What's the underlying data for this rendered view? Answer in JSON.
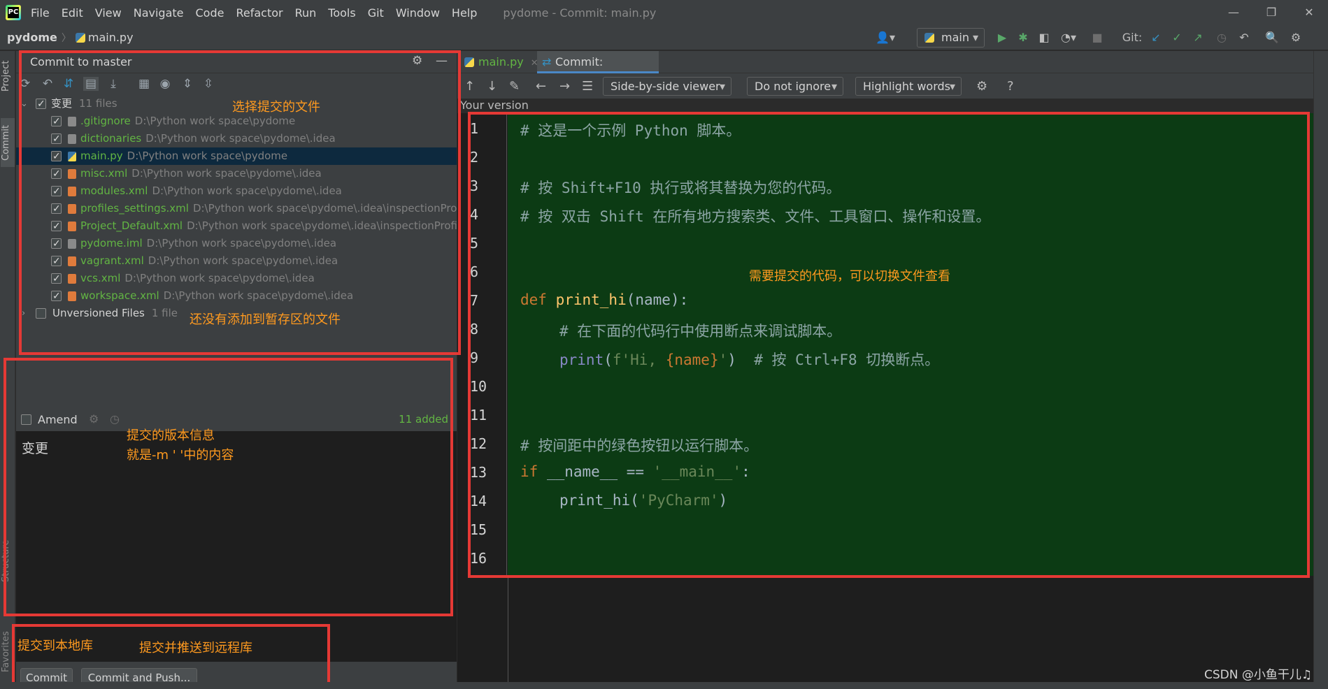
{
  "menu": [
    "File",
    "Edit",
    "View",
    "Navigate",
    "Code",
    "Refactor",
    "Run",
    "Tools",
    "Git",
    "Window",
    "Help"
  ],
  "window_title": "pydome - Commit: main.py",
  "breadcrumb": {
    "project": "pydome",
    "file": "main.py"
  },
  "branch": "main",
  "git_label": "Git:",
  "left_stripe": {
    "project": "Project",
    "commit": "Commit",
    "structure": "Structure",
    "favorites": "Favorites"
  },
  "commit_panel": {
    "title": "Commit to master",
    "changes_group": "变更",
    "changes_count": "11 files",
    "files": [
      {
        "name": ".gitignore",
        "path": "D:\\Python work space\\pydome",
        "checked": true
      },
      {
        "name": "dictionaries",
        "path": "D:\\Python work space\\pydome\\.idea",
        "checked": true
      },
      {
        "name": "main.py",
        "path": "D:\\Python work space\\pydome",
        "checked": true
      },
      {
        "name": "misc.xml",
        "path": "D:\\Python work space\\pydome\\.idea",
        "checked": true
      },
      {
        "name": "modules.xml",
        "path": "D:\\Python work space\\pydome\\.idea",
        "checked": true
      },
      {
        "name": "profiles_settings.xml",
        "path": "D:\\Python work space\\pydome\\.idea\\inspectionProf",
        "checked": true
      },
      {
        "name": "Project_Default.xml",
        "path": "D:\\Python work space\\pydome\\.idea\\inspectionProfi",
        "checked": true
      },
      {
        "name": "pydome.iml",
        "path": "D:\\Python work space\\pydome\\.idea",
        "checked": true
      },
      {
        "name": "vagrant.xml",
        "path": "D:\\Python work space\\pydome\\.idea",
        "checked": true
      },
      {
        "name": "vcs.xml",
        "path": "D:\\Python work space\\pydome\\.idea",
        "checked": true
      },
      {
        "name": "workspace.xml",
        "path": "D:\\Python work space\\pydome\\.idea",
        "checked": true
      }
    ],
    "unversioned_group": "Unversioned Files",
    "unversioned_count": "1 file",
    "amend_label": "Amend",
    "added_status": "11 added",
    "commit_message": "变更",
    "commit_button": "Commit",
    "commit_push_button": "Commit and Push..."
  },
  "editor_tabs": [
    {
      "label": "main.py",
      "active": false
    },
    {
      "label": "Commit: main.py",
      "active": true
    }
  ],
  "diff_toolbar": {
    "viewer": "Side-by-side viewer",
    "ignore": "Do not ignore",
    "highlight": "Highlight words"
  },
  "your_version": "Your version",
  "code_lines": {
    "l1": "# 这是一个示例 Python 脚本。",
    "l3": "# 按 Shift+F10 执行或将其替换为您的代码。",
    "l4": "# 按 双击 Shift 在所有地方搜索类、文件、工具窗口、操作和设置。",
    "l7_kw": "def ",
    "l7_fn": "print_hi",
    "l7_rest": "(name):",
    "l8": "# 在下面的代码行中使用断点来调试脚本。",
    "l9_bi": "print",
    "l9_a": "(",
    "l9_str1": "f'Hi, ",
    "l9_b": "{name}",
    "l9_str2": "'",
    "l9_c": ")  ",
    "l9_cmt": "# 按 Ctrl+F8 切换断点。",
    "l12": "# 按间距中的绿色按钮以运行脚本。",
    "l13_kw": "if ",
    "l13_a": "__name__ == ",
    "l13_str": "'__main__'",
    "l13_b": ":",
    "l14_a": "print_hi(",
    "l14_str": "'PyCharm'",
    "l14_b": ")"
  },
  "line_numbers": [
    "1",
    "2",
    "3",
    "4",
    "5",
    "6",
    "7",
    "8",
    "9",
    "10",
    "11",
    "12",
    "13",
    "14",
    "15",
    "16"
  ],
  "annotations": {
    "select_files": "选择提交的文件",
    "unversioned": "还没有添加到暂存区的文件",
    "code_note": "需要提交的代码，可以切换文件查看",
    "msg_note_1": "提交的版本信息",
    "msg_note_2": "就是-m ' '中的内容",
    "commit_local": "提交到本地库",
    "commit_remote": "提交并推送到远程库"
  },
  "watermark": "CSDN @小鱼干儿♫"
}
